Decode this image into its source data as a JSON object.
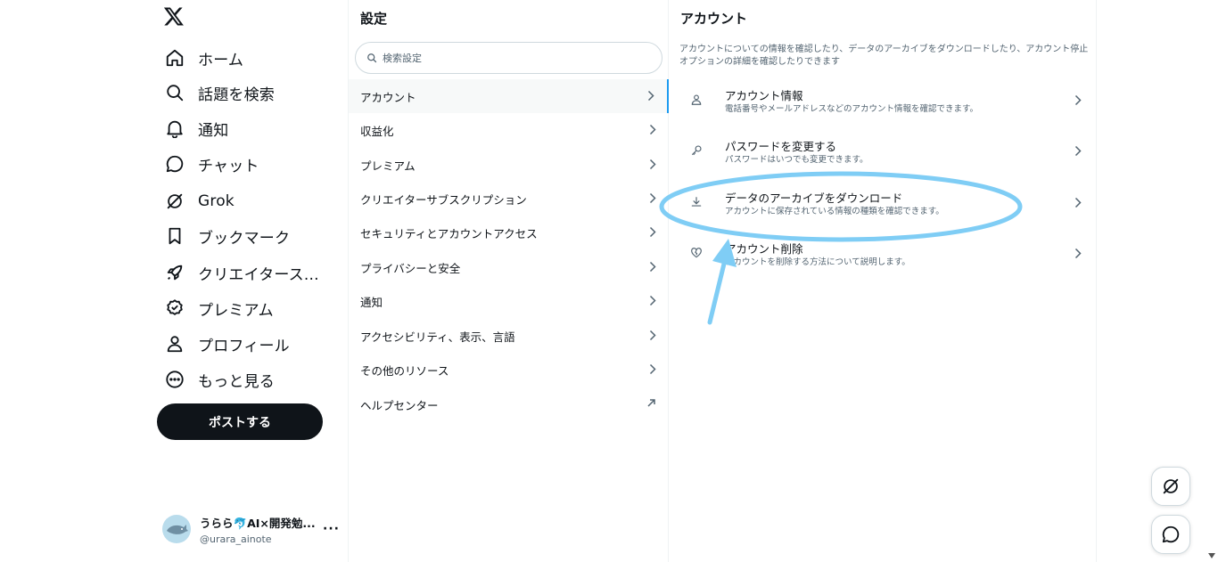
{
  "nav": {
    "items": [
      {
        "label": "ホーム",
        "icon": "home-icon"
      },
      {
        "label": "話題を検索",
        "icon": "search-icon"
      },
      {
        "label": "通知",
        "icon": "bell-icon"
      },
      {
        "label": "チャット",
        "icon": "chat-bubble-icon"
      },
      {
        "label": "Grok",
        "icon": "grok-icon"
      },
      {
        "label": "ブックマーク",
        "icon": "bookmark-icon"
      },
      {
        "label": "クリエイタース...",
        "icon": "rocket-icon"
      },
      {
        "label": "プレミアム",
        "icon": "verified-badge-icon"
      },
      {
        "label": "プロフィール",
        "icon": "person-icon"
      },
      {
        "label": "もっと見る",
        "icon": "more-circle-icon"
      }
    ],
    "post_button": "ポストする",
    "account": {
      "name": "うらら🐬AI×開発勉...",
      "handle": "@urara_ainote",
      "more": "···"
    }
  },
  "settings": {
    "title": "設定",
    "search_placeholder": "検索設定",
    "items": [
      {
        "label": "アカウント",
        "active": true
      },
      {
        "label": "収益化"
      },
      {
        "label": "プレミアム"
      },
      {
        "label": "クリエイターサブスクリプション"
      },
      {
        "label": "セキュリティとアカウントアクセス"
      },
      {
        "label": "プライバシーと安全"
      },
      {
        "label": "通知"
      },
      {
        "label": "アクセシビリティ、表示、言語"
      },
      {
        "label": "その他のリソース"
      },
      {
        "label": "ヘルプセンター",
        "external": true
      }
    ]
  },
  "account": {
    "title": "アカウント",
    "description": "アカウントについての情報を確認したり、データのアーカイブをダウンロードしたり、アカウント停止オプションの詳細を確認したりできます",
    "items": [
      {
        "title": "アカウント情報",
        "desc": "電話番号やメールアドレスなどのアカウント情報を確認できます。",
        "icon": "person-icon"
      },
      {
        "title": "パスワードを変更する",
        "desc": "パスワードはいつでも変更できます。",
        "icon": "key-icon"
      },
      {
        "title": "データのアーカイブをダウンロード",
        "desc": "アカウントに保存されている情報の種類を確認できます。",
        "icon": "download-icon"
      },
      {
        "title": "アカウント削除",
        "desc": "アカウントを削除する方法について説明します。",
        "icon": "broken-heart-icon"
      }
    ]
  },
  "annotation": {
    "color": "#7fcdf5"
  },
  "colors": {
    "accent": "#1d9bf0",
    "text": "#0f1419",
    "secondary": "#536471",
    "border": "#eff3f4"
  }
}
